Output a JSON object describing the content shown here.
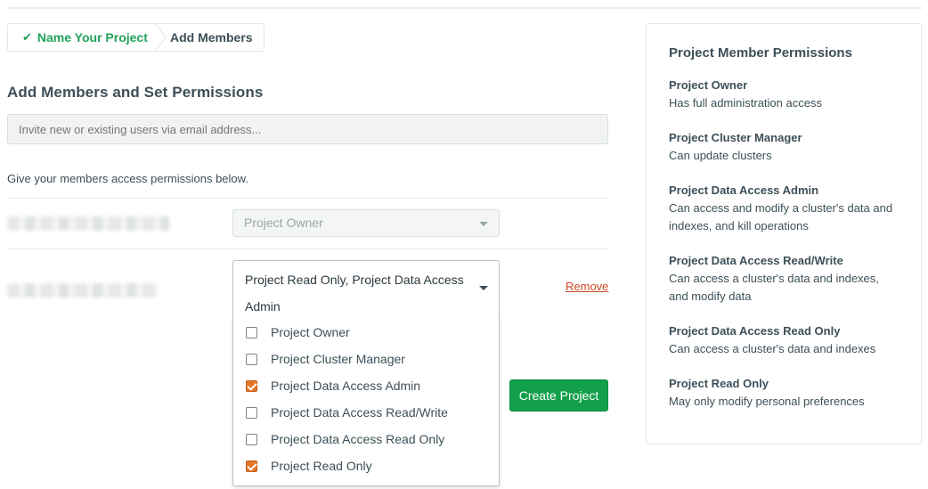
{
  "breadcrumb": {
    "step1": "Name Your Project",
    "step2": "Add Members",
    "step1_color": "#21a35b"
  },
  "section": {
    "title": "Add Members and Set Permissions",
    "invite_placeholder": "Invite new or existing users via email address...",
    "instructions": "Give your members access permissions below."
  },
  "members": [
    {
      "role_display": "Project Owner",
      "disabled": true
    },
    {
      "role_display": "Project Read Only, Project Data Access Admin",
      "remove_label": "Remove"
    }
  ],
  "role_options": [
    {
      "label": "Project Owner",
      "checked": false
    },
    {
      "label": "Project Cluster Manager",
      "checked": false
    },
    {
      "label": "Project Data Access Admin",
      "checked": true
    },
    {
      "label": "Project Data Access Read/Write",
      "checked": false
    },
    {
      "label": "Project Data Access Read Only",
      "checked": false
    },
    {
      "label": "Project Read Only",
      "checked": true
    }
  ],
  "actions": {
    "create_label": "Create Project",
    "create_color": "#13a04b"
  },
  "permissions_panel": {
    "title": "Project Member Permissions",
    "items": [
      {
        "name": "Project Owner",
        "desc": "Has full administration access"
      },
      {
        "name": "Project Cluster Manager",
        "desc": "Can update clusters"
      },
      {
        "name": "Project Data Access Admin",
        "desc": "Can access and modify a cluster's data and indexes, and kill operations"
      },
      {
        "name": "Project Data Access Read/Write",
        "desc": "Can access a cluster's data and indexes, and modify data"
      },
      {
        "name": "Project Data Access Read Only",
        "desc": "Can access a cluster's data and indexes"
      },
      {
        "name": "Project Read Only",
        "desc": "May only modify personal preferences"
      }
    ]
  }
}
